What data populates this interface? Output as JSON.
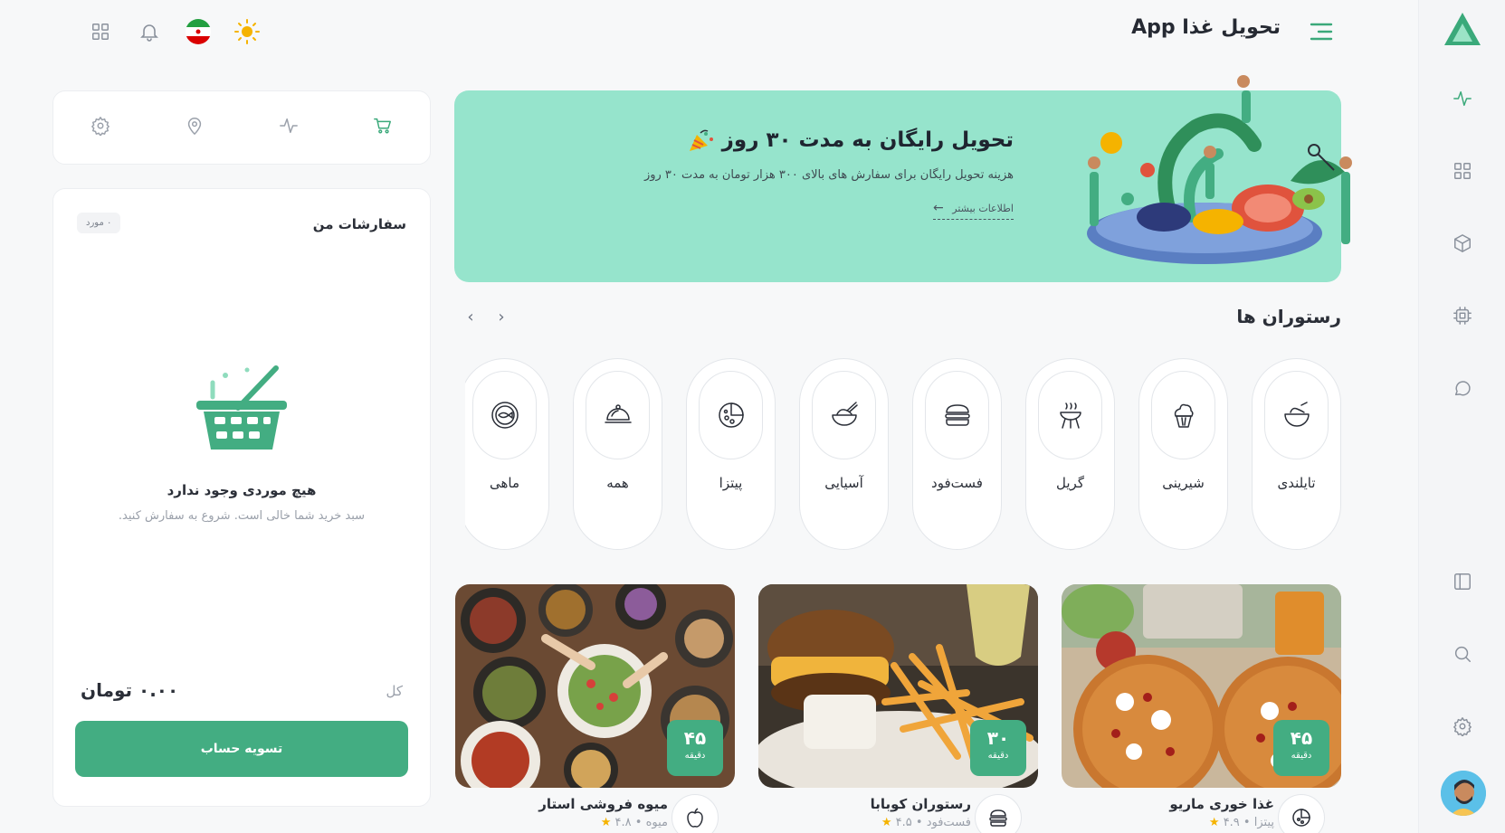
{
  "header": {
    "app_title": "تحویل غذا App",
    "icons": [
      "grid-icon",
      "bell-icon",
      "iran-flag-icon",
      "sun-icon"
    ]
  },
  "rail": {
    "items": [
      "activity-icon",
      "grid-icon",
      "box-icon",
      "cpu-icon",
      "chat-icon",
      "sidebar-icon",
      "search-icon",
      "settings-icon"
    ]
  },
  "quick_actions": [
    "cart-icon",
    "activity-icon",
    "location-icon",
    "settings-icon"
  ],
  "orders": {
    "title": "سفارشات من",
    "badge": "۰ مورد",
    "empty_title": "هیچ موردی وجود ندارد",
    "empty_subtitle": "سبد خرید شما خالی است. شروع به سفارش کنید.",
    "total_label": "کل",
    "total_value": "۰.۰۰ تومان",
    "checkout_label": "تسویه حساب"
  },
  "banner": {
    "title": "تحویل رایگان به مدت ۳۰ روز",
    "subtitle": "هزینه تحویل رایگان برای سفارش های بالای ۳۰۰ هزار تومان به مدت ۳۰ روز",
    "link": "اطلاعات بیشتر"
  },
  "restaurants": {
    "title": "رستوران ها",
    "categories": [
      {
        "label": "تایلندی",
        "icon": "salad-bowl-icon"
      },
      {
        "label": "شیرینی",
        "icon": "cupcake-icon"
      },
      {
        "label": "گریل",
        "icon": "grill-icon"
      },
      {
        "label": "فست‌فود",
        "icon": "burger-icon"
      },
      {
        "label": "آسیایی",
        "icon": "rice-bowl-icon"
      },
      {
        "label": "پیتزا",
        "icon": "pizza-icon"
      },
      {
        "label": "همه",
        "icon": "cloche-icon"
      },
      {
        "label": "ماهی",
        "icon": "fish-plate-icon"
      }
    ],
    "cards": [
      {
        "name": "غذا خوری ماریو",
        "category": "پیتزا",
        "rating": "۴.۹",
        "time": "۴۵",
        "time_unit": "دقیقه",
        "icon": "pizza-icon"
      },
      {
        "name": "رستوران کوبابا",
        "category": "فست‌فود",
        "rating": "۴.۵",
        "time": "۳۰",
        "time_unit": "دقیقه",
        "icon": "burger-icon"
      },
      {
        "name": "میوه فروشی استار",
        "category": "میوه",
        "rating": "۴.۸",
        "time": "۴۵",
        "time_unit": "دقیقه",
        "icon": "apple-icon"
      }
    ]
  },
  "colors": {
    "accent": "#43ad82",
    "banner_bg": "#96e4cc",
    "star": "#f5b300"
  }
}
